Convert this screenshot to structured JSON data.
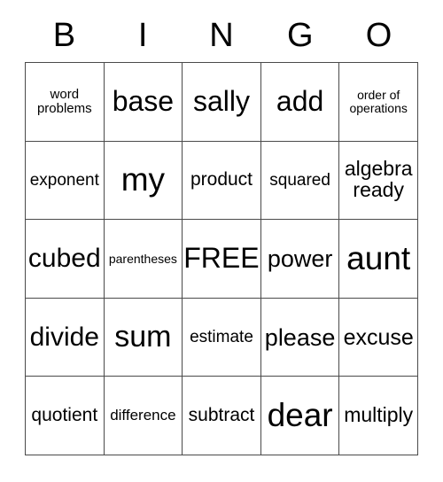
{
  "card": {
    "title_letters": [
      "B",
      "I",
      "N",
      "G",
      "O"
    ],
    "border_color": "#4a4a4a",
    "text_color": "#000000",
    "background_color": "#ffffff",
    "columns": 5,
    "rows": 5,
    "free_space": {
      "row": 3,
      "column": 3,
      "label": "FREE!"
    }
  },
  "cells": [
    {
      "text": "word\nproblems",
      "size": "fs-xs",
      "lines": 2,
      "column_letter": "B",
      "row": 1
    },
    {
      "text": "base",
      "size": "fs-h1",
      "lines": 1,
      "column_letter": "I",
      "row": 1
    },
    {
      "text": "sally",
      "size": "fs-h1",
      "lines": 1,
      "column_letter": "N",
      "row": 1
    },
    {
      "text": "add",
      "size": "fs-h1",
      "lines": 1,
      "column_letter": "G",
      "row": 1
    },
    {
      "text": "order of\noperations",
      "size": "fs-xxs",
      "lines": 2,
      "column_letter": "O",
      "row": 1
    },
    {
      "text": "exponent",
      "size": "fs-sm",
      "lines": 1,
      "column_letter": "B",
      "row": 2
    },
    {
      "text": "my",
      "size": "fs-h3",
      "lines": 1,
      "column_letter": "I",
      "row": 2
    },
    {
      "text": "product",
      "size": "fs-m",
      "lines": 1,
      "column_letter": "N",
      "row": 2
    },
    {
      "text": "squared",
      "size": "fs-sm",
      "lines": 1,
      "column_letter": "G",
      "row": 2
    },
    {
      "text": "algebra\nready",
      "size": "fs-ml",
      "lines": 2,
      "column_letter": "O",
      "row": 2
    },
    {
      "text": "cubed",
      "size": "fs-xxl",
      "lines": 1,
      "column_letter": "B",
      "row": 3
    },
    {
      "text": "parentheses",
      "size": "fs-xxs",
      "lines": 1,
      "column_letter": "I",
      "row": 3
    },
    {
      "text": "FREE!",
      "size": "fs-h1",
      "lines": 1,
      "column_letter": "N",
      "row": 3
    },
    {
      "text": "power",
      "size": "fs-xl",
      "lines": 1,
      "column_letter": "G",
      "row": 3
    },
    {
      "text": "aunt",
      "size": "fs-h3",
      "lines": 1,
      "column_letter": "O",
      "row": 3
    },
    {
      "text": "divide",
      "size": "fs-xxl",
      "lines": 1,
      "column_letter": "B",
      "row": 4
    },
    {
      "text": "sum",
      "size": "fs-h2",
      "lines": 1,
      "column_letter": "I",
      "row": 4
    },
    {
      "text": "estimate",
      "size": "fs-sm",
      "lines": 1,
      "column_letter": "N",
      "row": 4
    },
    {
      "text": "please",
      "size": "fs-xl",
      "lines": 1,
      "column_letter": "G",
      "row": 4
    },
    {
      "text": "excuse",
      "size": "fs-l",
      "lines": 1,
      "column_letter": "O",
      "row": 4
    },
    {
      "text": "quotient",
      "size": "fs-m",
      "lines": 1,
      "column_letter": "B",
      "row": 5
    },
    {
      "text": "difference",
      "size": "fs-s",
      "lines": 1,
      "column_letter": "I",
      "row": 5
    },
    {
      "text": "subtract",
      "size": "fs-m",
      "lines": 1,
      "column_letter": "N",
      "row": 5
    },
    {
      "text": "dear",
      "size": "fs-h3",
      "lines": 1,
      "column_letter": "G",
      "row": 5
    },
    {
      "text": "multiply",
      "size": "fs-ml",
      "lines": 1,
      "column_letter": "O",
      "row": 5
    }
  ]
}
